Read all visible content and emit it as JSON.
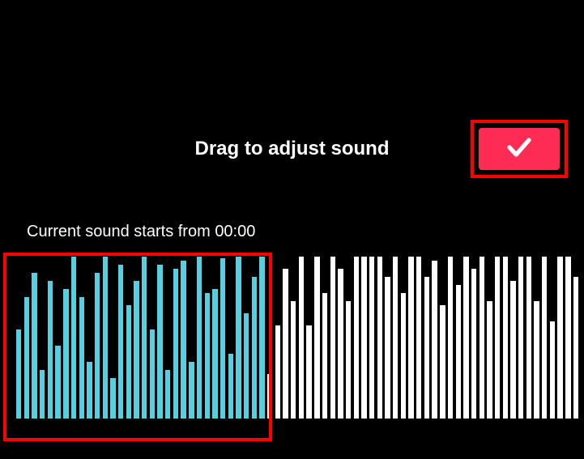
{
  "title": "Drag to adjust sound",
  "status_prefix": "Current sound starts from ",
  "status_time": "00:00",
  "colors": {
    "accent": "#fe2c55",
    "highlight": "#ff0000",
    "selected_bar": "#55d0e0",
    "bar": "#ffffff"
  },
  "waveform": {
    "selected_count": 32,
    "heights": [
      110,
      150,
      180,
      60,
      170,
      90,
      160,
      200,
      150,
      70,
      180,
      200,
      50,
      190,
      140,
      170,
      200,
      110,
      190,
      60,
      185,
      195,
      70,
      200,
      155,
      160,
      198,
      80,
      200,
      130,
      175,
      200,
      55,
      115,
      185,
      145,
      200,
      115,
      200,
      155,
      200,
      185,
      145,
      200,
      200,
      200,
      200,
      175,
      200,
      155,
      200,
      200,
      175,
      195,
      140,
      200,
      165,
      200,
      185,
      200,
      145,
      200,
      200,
      170,
      200,
      200,
      145,
      200,
      120,
      200,
      200,
      175
    ]
  }
}
